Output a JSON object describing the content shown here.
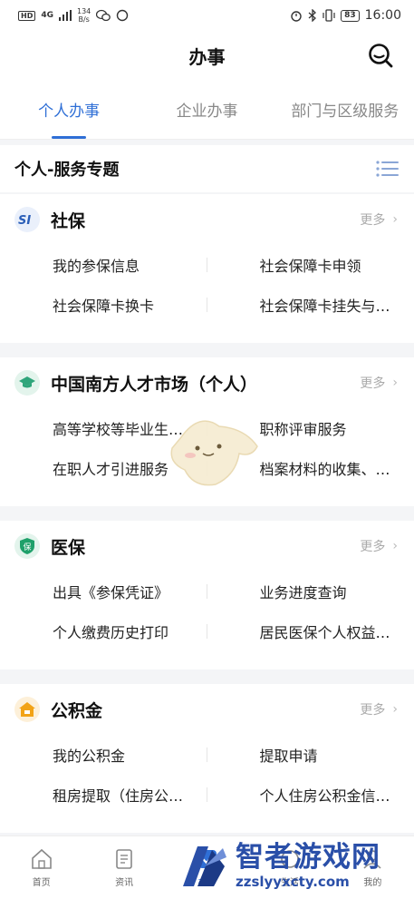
{
  "status_bar": {
    "hd": "HD",
    "net_type": "4G",
    "speed_value": "134",
    "speed_unit": "B/s",
    "battery": "83",
    "time": "16:00"
  },
  "header": {
    "title": "办事"
  },
  "tabs": [
    {
      "label": "个人办事",
      "active": true
    },
    {
      "label": "企业办事",
      "active": false
    },
    {
      "label": "部门与区级服务",
      "active": false
    }
  ],
  "section": {
    "title": "个人-服务专题"
  },
  "cards": [
    {
      "title": "社保",
      "icon": "si-logo-icon",
      "more": "更多",
      "items": [
        "我的参保信息",
        "社会保障卡申领",
        "社会保障卡换卡",
        "社会保障卡挂失与…"
      ]
    },
    {
      "title": "中国南方人才市场（个人）",
      "icon": "graduation-cap-icon",
      "more": "更多",
      "items": [
        "高等学校等毕业生…",
        "职称评审服务",
        "在职人才引进服务",
        "档案材料的收集、…"
      ]
    },
    {
      "title": "医保",
      "icon": "shield-bao-icon",
      "more": "更多",
      "items": [
        "出具《参保凭证》",
        "业务进度查询",
        "个人缴费历史打印",
        "居民医保个人权益…"
      ]
    },
    {
      "title": "公积金",
      "icon": "house-icon",
      "more": "更多",
      "items": [
        "我的公积金",
        "提取申请",
        "租房提取（住房公…",
        "个人住房公积金信…"
      ]
    }
  ],
  "bottom_nav": [
    {
      "label": "首页",
      "icon": "home-icon",
      "active": false
    },
    {
      "label": "资讯",
      "icon": "document-icon",
      "active": false
    },
    {
      "label": "办事",
      "icon": "check-icon",
      "active": true
    },
    {
      "label": "生活",
      "icon": "life-icon",
      "active": false
    },
    {
      "label": "我的",
      "icon": "user-icon",
      "active": false
    }
  ],
  "watermark": {
    "big": "智者游戏网",
    "small": "zzslyyxcty.com"
  },
  "colors": {
    "accent": "#2f6fd6",
    "si": "#2b5fb8",
    "talent": "#2fa57a",
    "yibao": "#1fa06a",
    "gjj": "#f2a317"
  }
}
